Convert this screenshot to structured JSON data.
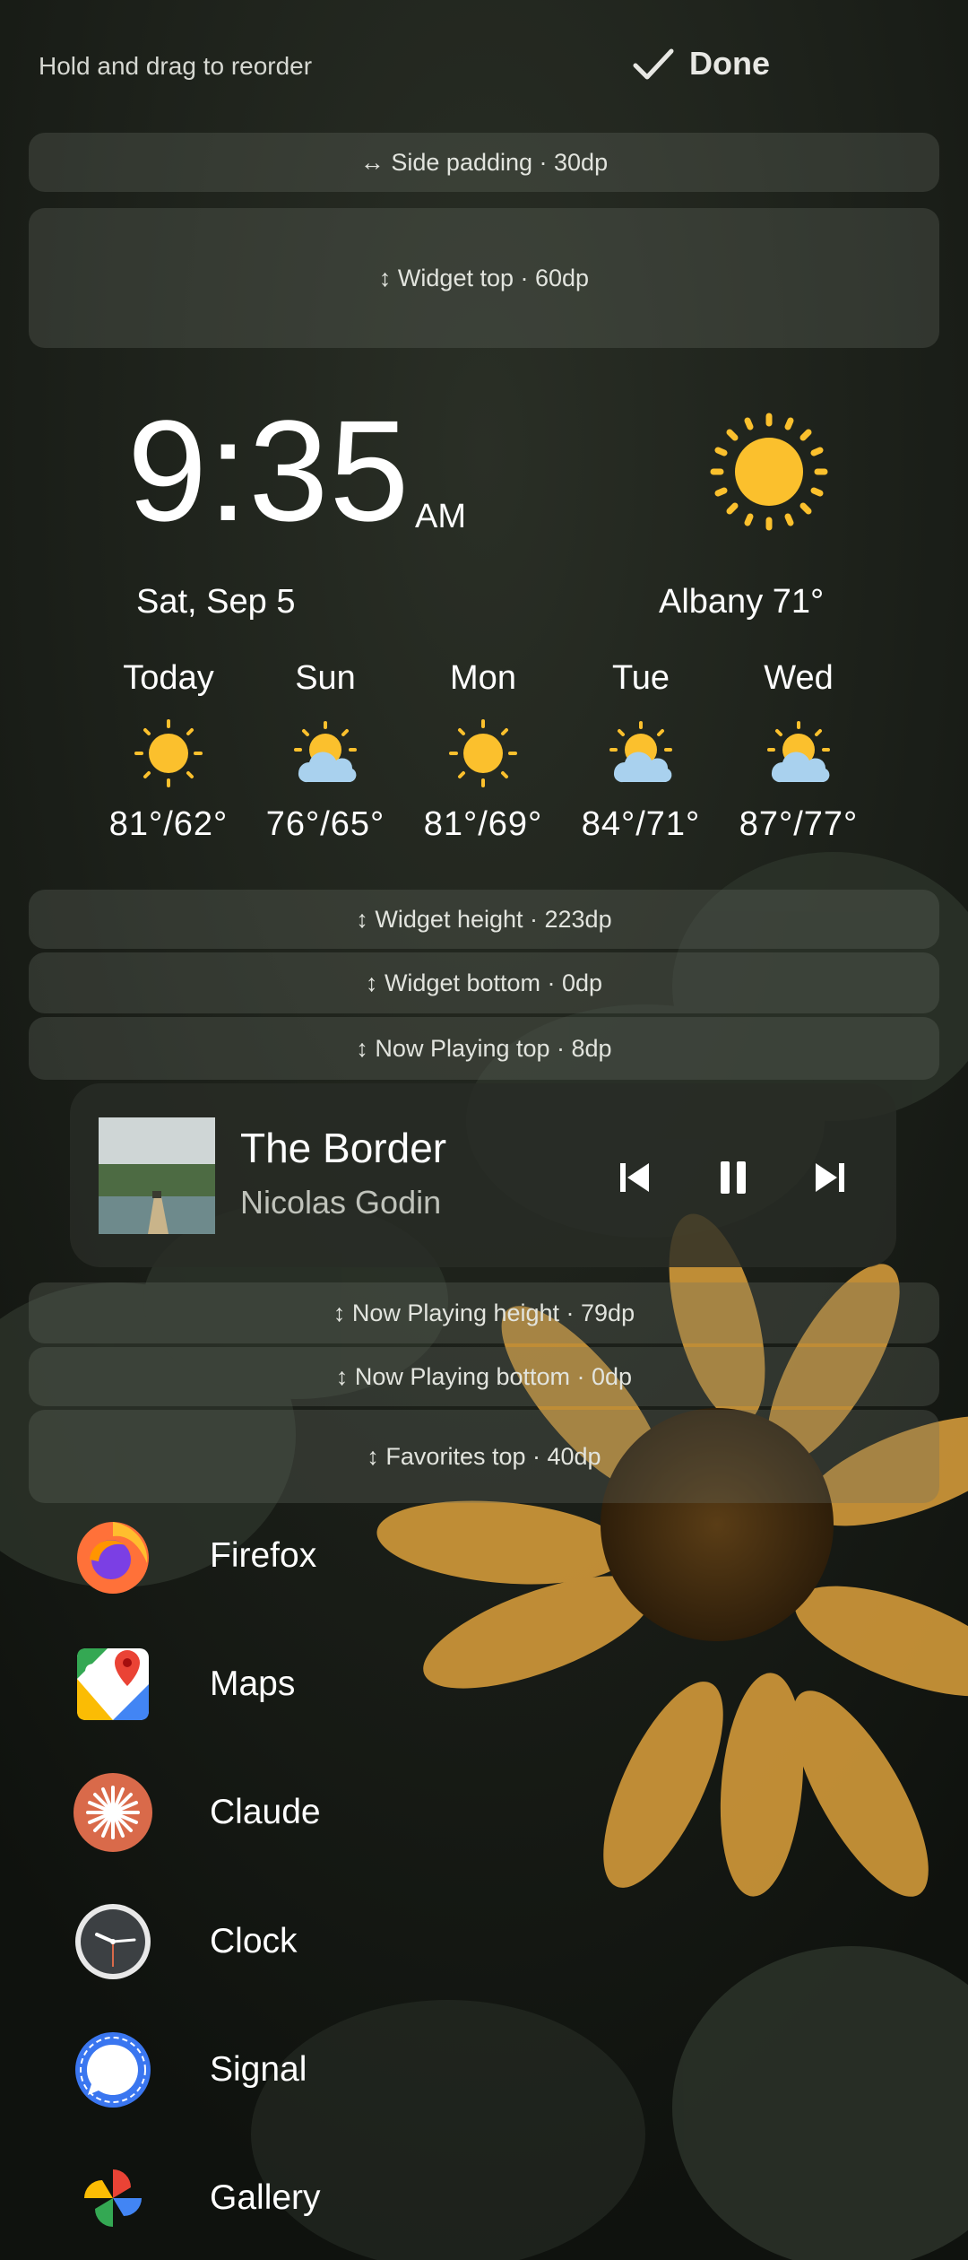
{
  "header": {
    "hint": "Hold and drag to reorder",
    "done_label": "Done"
  },
  "spacing_controls": {
    "side_padding": "↔ Side padding · 30dp",
    "widget_top": "↕ Widget top · 60dp",
    "widget_height": "↕ Widget height · 223dp",
    "widget_bottom": "↕ Widget bottom · 0dp",
    "now_playing_top": "↕ Now Playing top · 8dp",
    "now_playing_height": "↕ Now Playing height · 79dp",
    "now_playing_bottom": "↕ Now Playing bottom · 0dp",
    "favorites_top": "↕ Favorites top · 40dp"
  },
  "clock": {
    "time": "9:35",
    "ampm": "AM",
    "date": "Sat, Sep 5"
  },
  "weather": {
    "current_icon": "sun-icon",
    "location_temp": "Albany 71°",
    "forecast": [
      {
        "day": "Today",
        "icon": "sun-icon",
        "temps": "81°/62°"
      },
      {
        "day": "Sun",
        "icon": "partly-cloudy-icon",
        "temps": "76°/65°"
      },
      {
        "day": "Mon",
        "icon": "sun-icon",
        "temps": "81°/69°"
      },
      {
        "day": "Tue",
        "icon": "partly-cloudy-icon",
        "temps": "84°/71°"
      },
      {
        "day": "Wed",
        "icon": "partly-cloudy-icon",
        "temps": "87°/77°"
      }
    ]
  },
  "now_playing": {
    "title": "The Border",
    "artist": "Nicolas Godin"
  },
  "favorites": [
    {
      "label": "Firefox",
      "icon": "firefox-icon"
    },
    {
      "label": "Maps",
      "icon": "maps-icon"
    },
    {
      "label": "Claude",
      "icon": "claude-icon"
    },
    {
      "label": "Clock",
      "icon": "clock-icon"
    },
    {
      "label": "Signal",
      "icon": "signal-icon"
    },
    {
      "label": "Gallery",
      "icon": "gallery-icon"
    }
  ],
  "colors": {
    "sun": "#FBC02D",
    "cloud": "#A9D1EE",
    "flower": "#D9A040",
    "accent_claude": "#D96A4A"
  }
}
